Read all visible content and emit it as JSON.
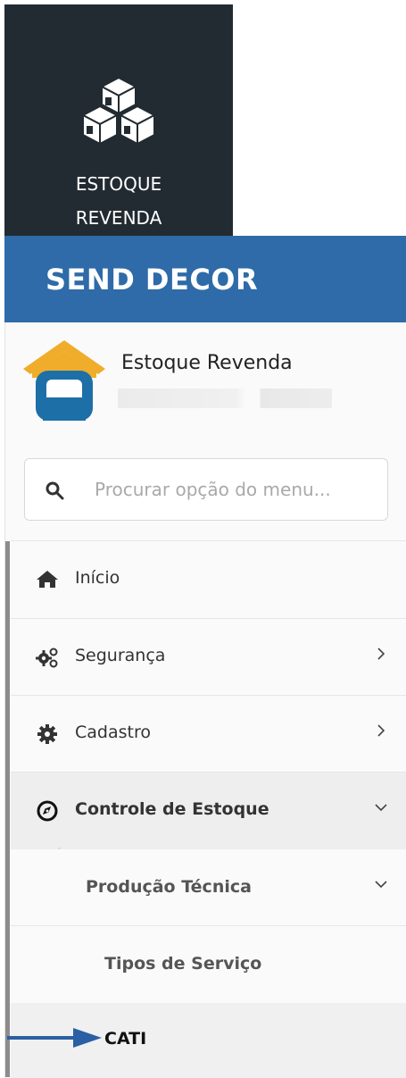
{
  "tile": {
    "label_line1": "ESTOQUE",
    "label_line2": "REVENDA",
    "icon": "cubes-icon"
  },
  "brand": {
    "title": "SEND DECOR"
  },
  "user": {
    "name": "Estoque Revenda",
    "avatar": "sofa-house-icon"
  },
  "search": {
    "placeholder": "Procurar opção do menu...",
    "value": ""
  },
  "menu": {
    "inicio": {
      "label": "Início",
      "icon": "home-icon"
    },
    "seguranca": {
      "label": "Segurança",
      "icon": "gears-icon"
    },
    "cadastro": {
      "label": "Cadastro",
      "icon": "gear-icon"
    },
    "controle": {
      "label": "Controle de Estoque",
      "icon": "compass-icon"
    },
    "producao": {
      "label": "Produção Técnica"
    },
    "tipos": {
      "label": "Tipos de Serviço"
    },
    "cati": {
      "label": "CATI"
    }
  },
  "colors": {
    "brand_bar": "#2e6ba8",
    "tile_bg": "#222b31",
    "arrow": "#2b5fa3"
  }
}
